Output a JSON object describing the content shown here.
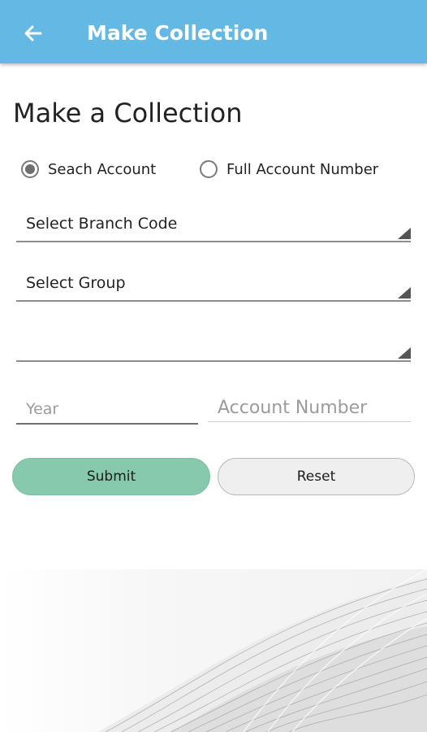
{
  "appbar": {
    "back_icon": "arrow-left-icon",
    "title": "Make Collection",
    "color": "#63b9e4"
  },
  "page": {
    "heading": "Make a Collection"
  },
  "search_mode": {
    "options": [
      {
        "label": "Seach Account",
        "selected": true
      },
      {
        "label": "Full Account Number",
        "selected": false
      }
    ]
  },
  "dropdowns": {
    "branch_code": {
      "value": "Select Branch Code"
    },
    "group": {
      "value": "Select Group"
    },
    "third": {
      "value": ""
    }
  },
  "inputs": {
    "year": {
      "placeholder": "Year",
      "value": ""
    },
    "account_number": {
      "placeholder": "Account Number",
      "value": ""
    }
  },
  "buttons": {
    "submit": {
      "label": "Submit",
      "color": "#86c9ac"
    },
    "reset": {
      "label": "Reset",
      "color": "#efefef"
    }
  }
}
